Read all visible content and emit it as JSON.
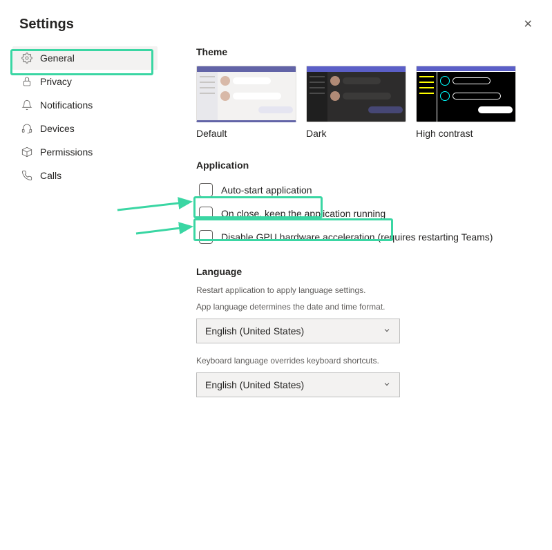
{
  "title": "Settings",
  "sidebar": {
    "items": [
      {
        "label": "General",
        "icon": "gear-icon",
        "active": true
      },
      {
        "label": "Privacy",
        "icon": "lock-icon",
        "active": false
      },
      {
        "label": "Notifications",
        "icon": "bell-icon",
        "active": false
      },
      {
        "label": "Devices",
        "icon": "headset-icon",
        "active": false
      },
      {
        "label": "Permissions",
        "icon": "package-icon",
        "active": false
      },
      {
        "label": "Calls",
        "icon": "phone-icon",
        "active": false
      }
    ]
  },
  "theme": {
    "heading": "Theme",
    "options": [
      {
        "label": "Default",
        "selected": true
      },
      {
        "label": "Dark",
        "selected": false
      },
      {
        "label": "High contrast",
        "selected": false
      }
    ]
  },
  "application": {
    "heading": "Application",
    "checkboxes": [
      {
        "label": "Auto-start application",
        "checked": false
      },
      {
        "label": "On close, keep the application running",
        "checked": false
      },
      {
        "label": "Disable GPU hardware acceleration (requires restarting Teams)",
        "checked": false
      }
    ]
  },
  "language": {
    "heading": "Language",
    "hint1": "Restart application to apply language settings.",
    "hint2": "App language determines the date and time format.",
    "app_language": "English (United States)",
    "hint3": "Keyboard language overrides keyboard shortcuts.",
    "keyboard_language": "English (United States)"
  },
  "annotation_color": "#3ad6a3"
}
